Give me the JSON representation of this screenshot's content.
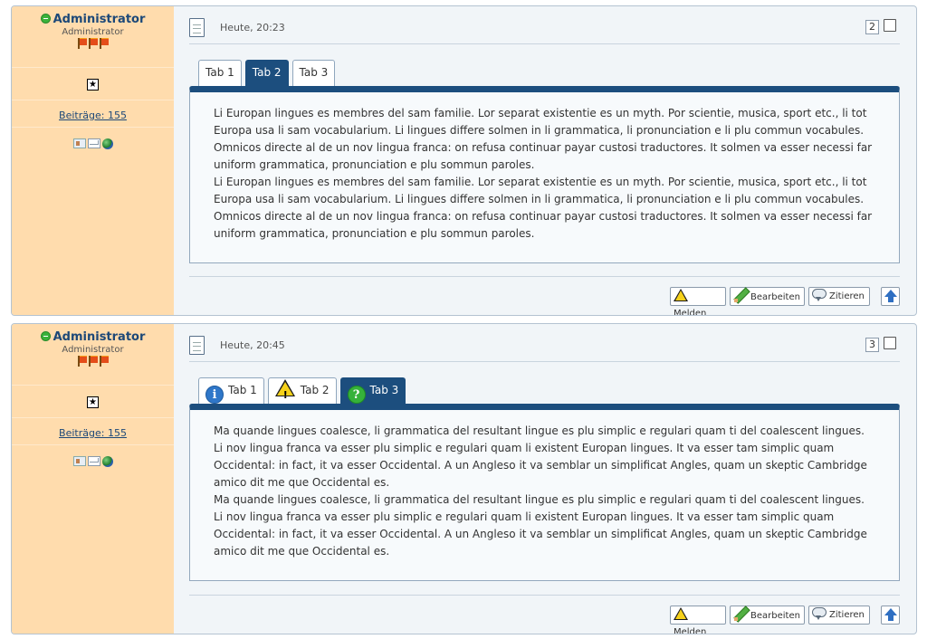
{
  "posts": [
    {
      "user": {
        "name": "Administrator",
        "role": "Administrator",
        "posts_label": "Beiträge: 155",
        "rank_badge": "★",
        "online": true
      },
      "date": "Heute, 20:23",
      "number": "2",
      "tabs": [
        {
          "label": "Tab 1",
          "icon": null,
          "active": false
        },
        {
          "label": "Tab 2",
          "icon": null,
          "active": true
        },
        {
          "label": "Tab 3",
          "icon": null,
          "active": false
        }
      ],
      "content": "Li Europan lingues es membres del sam familie. Lor separat existentie es un myth. Por scientie, musica, sport etc., li tot Europa usa li sam vocabularium. Li lingues differe solmen in li grammatica, li pronunciation e li plu commun vocabules. Omnicos directe al de un nov lingua franca: on refusa continuar payar custosi traductores. It solmen va esser necessi far uniform grammatica, pronunciation e plu sommun paroles.\nLi Europan lingues es membres del sam familie. Lor separat existentie es un myth. Por scientie, musica, sport etc., li tot Europa usa li sam vocabularium. Li lingues differe solmen in li grammatica, li pronunciation e li plu commun vocabules. Omnicos directe al de un nov lingua franca: on refusa continuar payar custosi traductores. It solmen va esser necessi far uniform grammatica, pronunciation e plu sommun paroles."
    },
    {
      "user": {
        "name": "Administrator",
        "role": "Administrator",
        "posts_label": "Beiträge: 155",
        "rank_badge": "★",
        "online": true
      },
      "date": "Heute, 20:45",
      "number": "3",
      "tabs": [
        {
          "label": "Tab 1",
          "icon": "info-icon",
          "active": false
        },
        {
          "label": "Tab 2",
          "icon": "warning-icon",
          "active": false
        },
        {
          "label": "Tab 3",
          "icon": "help-icon",
          "active": true
        }
      ],
      "content": "Ma quande lingues coalesce, li grammatica del resultant lingue es plu simplic e regulari quam ti del coalescent lingues. Li nov lingua franca va esser plu simplic e regulari quam li existent Europan lingues. It va esser tam simplic quam Occidental: in fact, it va esser Occidental. A un Angleso it va semblar un simplificat Angles, quam un skeptic Cambridge amico dit me que Occidental es.\nMa quande lingues coalesce, li grammatica del resultant lingue es plu simplic e regulari quam ti del coalescent lingues. Li nov lingua franca va esser plu simplic e regulari quam li existent Europan lingues. It va esser tam simplic quam Occidental: in fact, it va esser Occidental. A un Angleso it va semblar un simplificat Angles, quam un skeptic Cambridge amico dit me que Occidental es."
    }
  ],
  "actions": {
    "report": "Melden",
    "edit": "Bearbeiten",
    "quote": "Zitieren"
  },
  "colors": {
    "sidebar": "#ffdcad",
    "accent": "#1c4e7e",
    "link": "#1c4878"
  }
}
